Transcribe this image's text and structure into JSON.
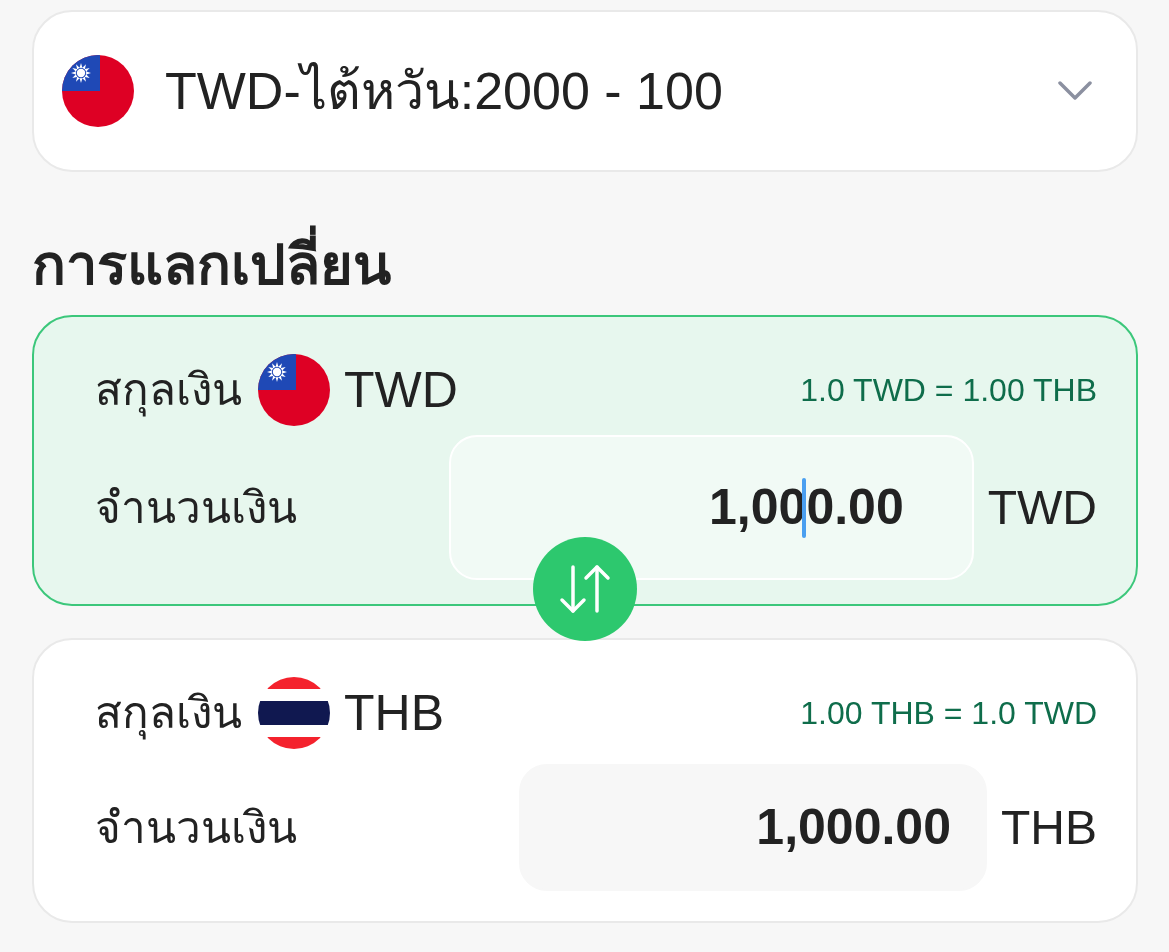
{
  "currency_select": {
    "flag": {
      "kind": "taiwan"
    },
    "label": "TWD-ไต้หวัน:2000 - 100"
  },
  "section_title": "การแลกเปลี่ยน",
  "converters": [
    {
      "active": true,
      "currency_label": "สกุลเงิน",
      "flag": {
        "kind": "taiwan"
      },
      "currency_code": "TWD",
      "rate": "1.0 TWD = 1.00 THB",
      "amount_label": "จำนวนเงิน",
      "amount": "1,000.00",
      "focused": true,
      "unit": "TWD"
    },
    {
      "active": false,
      "currency_label": "สกุลเงิน",
      "flag": {
        "kind": "thailand"
      },
      "currency_code": "THB",
      "rate": "1.00 THB = 1.0 TWD",
      "amount_label": "จำนวนเงิน",
      "amount": "1,000.00",
      "focused": false,
      "unit": "THB"
    }
  ]
}
